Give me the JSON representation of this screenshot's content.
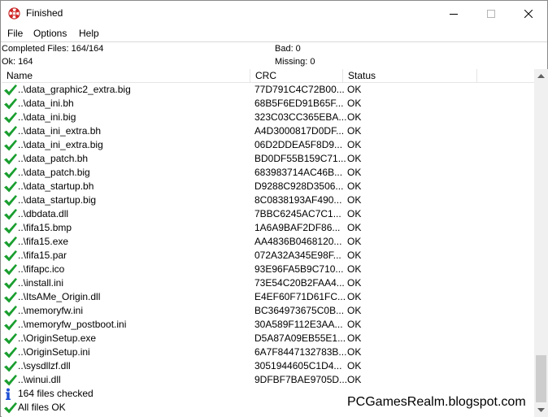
{
  "window": {
    "title": "Finished",
    "icon": "lifebuoy-icon"
  },
  "menu": {
    "items": [
      {
        "label": "File"
      },
      {
        "label": "Options"
      },
      {
        "label": "Help"
      }
    ]
  },
  "summary": {
    "completed": "Completed Files: 164/164",
    "bad": "Bad: 0",
    "ok": "Ok: 164",
    "missing": "Missing: 0"
  },
  "columns": {
    "name": "Name",
    "crc": "CRC",
    "status": "Status"
  },
  "colors": {
    "check_green": "#1a9e2f",
    "info_blue": "#1c4fd6"
  },
  "rows": [
    {
      "icon": "checkmark-icon",
      "name": "..\\data_graphic2_extra.big",
      "crc": "77D791C4C72B00...",
      "status": "OK"
    },
    {
      "icon": "checkmark-icon",
      "name": "..\\data_ini.bh",
      "crc": "68B5F6ED91B65F...",
      "status": "OK"
    },
    {
      "icon": "checkmark-icon",
      "name": "..\\data_ini.big",
      "crc": "323C03CC365EBA...",
      "status": "OK"
    },
    {
      "icon": "checkmark-icon",
      "name": "..\\data_ini_extra.bh",
      "crc": "A4D3000817D0DF...",
      "status": "OK"
    },
    {
      "icon": "checkmark-icon",
      "name": "..\\data_ini_extra.big",
      "crc": "06D2DDEA5F8D9...",
      "status": "OK"
    },
    {
      "icon": "checkmark-icon",
      "name": "..\\data_patch.bh",
      "crc": "BD0DF55B159C71...",
      "status": "OK"
    },
    {
      "icon": "checkmark-icon",
      "name": "..\\data_patch.big",
      "crc": "683983714AC46B...",
      "status": "OK"
    },
    {
      "icon": "checkmark-icon",
      "name": "..\\data_startup.bh",
      "crc": "D9288C928D3506...",
      "status": "OK"
    },
    {
      "icon": "checkmark-icon",
      "name": "..\\data_startup.big",
      "crc": "8C0838193AF490...",
      "status": "OK"
    },
    {
      "icon": "checkmark-icon",
      "name": "..\\dbdata.dll",
      "crc": "7BBC6245AC7C1...",
      "status": "OK"
    },
    {
      "icon": "checkmark-icon",
      "name": "..\\fifa15.bmp",
      "crc": "1A6A9BAF2DF86...",
      "status": "OK"
    },
    {
      "icon": "checkmark-icon",
      "name": "..\\fifa15.exe",
      "crc": "AA4836B0468120...",
      "status": "OK"
    },
    {
      "icon": "checkmark-icon",
      "name": "..\\fifa15.par",
      "crc": "072A32A345E98F...",
      "status": "OK"
    },
    {
      "icon": "checkmark-icon",
      "name": "..\\fifapc.ico",
      "crc": "93E96FA5B9C710...",
      "status": "OK"
    },
    {
      "icon": "checkmark-icon",
      "name": "..\\install.ini",
      "crc": "73E54C20B2FAA4...",
      "status": "OK"
    },
    {
      "icon": "checkmark-icon",
      "name": "..\\ItsAMe_Origin.dll",
      "crc": "E4EF60F71D61FC...",
      "status": "OK"
    },
    {
      "icon": "checkmark-icon",
      "name": "..\\memoryfw.ini",
      "crc": "BC364973675C0B...",
      "status": "OK"
    },
    {
      "icon": "checkmark-icon",
      "name": "..\\memoryfw_postboot.ini",
      "crc": "30A589F112E3AA...",
      "status": "OK"
    },
    {
      "icon": "checkmark-icon",
      "name": "..\\OriginSetup.exe",
      "crc": "D5A87A09EB55E1...",
      "status": "OK"
    },
    {
      "icon": "checkmark-icon",
      "name": "..\\OriginSetup.ini",
      "crc": "6A7F8447132783B...",
      "status": "OK"
    },
    {
      "icon": "checkmark-icon",
      "name": "..\\sysdllzf.dll",
      "crc": "3051944605C1D4...",
      "status": "OK"
    },
    {
      "icon": "checkmark-icon",
      "name": "..\\winui.dll",
      "crc": "9DFBF7BAE9705D...",
      "status": "OK"
    },
    {
      "icon": "info-icon",
      "name": "164 files checked",
      "crc": "",
      "status": ""
    },
    {
      "icon": "checkmark-icon",
      "name": "All files OK",
      "crc": "",
      "status": ""
    }
  ],
  "watermark": "PCGamesRealm.blogspot.com"
}
